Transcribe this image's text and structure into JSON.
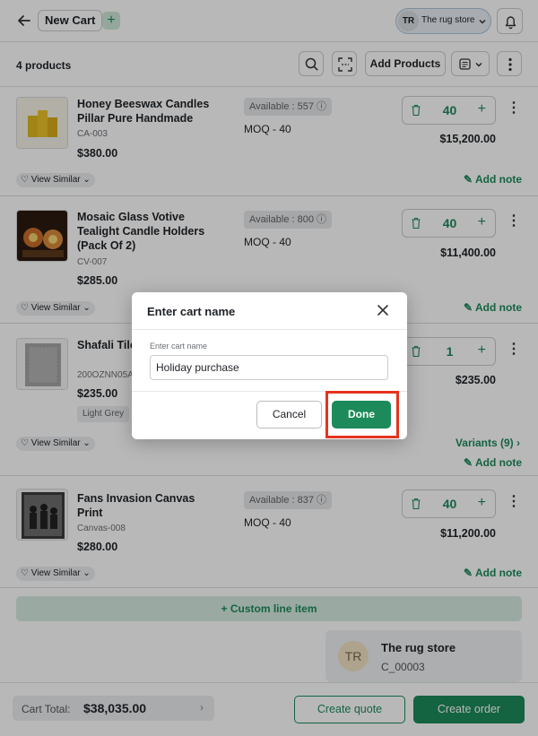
{
  "header": {
    "cart_name": "New Cart",
    "add_icon": "plus-icon",
    "store_initials": "TR",
    "store_name": "The rug store"
  },
  "toolbar": {
    "product_count": "4 products",
    "add_products_label": "Add Products"
  },
  "products": [
    {
      "name": "Honey Beeswax Candles Pillar Pure Handmade",
      "sku": "CA-003",
      "price": "$380.00",
      "available": "Available : 557",
      "moq": "MOQ - 40",
      "quantity": "40",
      "total": "$15,200.00",
      "view_similar": "View Similar",
      "add_note": "Add note"
    },
    {
      "name": "Mosaic Glass Votive Tealight Candle Holders (Pack Of 2)",
      "sku": "CV-007",
      "price": "$285.00",
      "available": "Available : 800",
      "moq": "MOQ - 40",
      "quantity": "40",
      "total": "$11,400.00",
      "view_similar": "View Similar",
      "add_note": "Add note"
    },
    {
      "name": "Shafali Tiled Rug",
      "sku": "200OZNN05A",
      "price": "$235.00",
      "tag": "Light Grey",
      "quantity": "1",
      "total": "$235.00",
      "view_similar": "View Similar",
      "variants": "Variants (9)",
      "add_note": "Add note"
    },
    {
      "name": "Fans Invasion Canvas Print",
      "sku": "Canvas-008",
      "price": "$280.00",
      "available": "Available : 837",
      "moq": "MOQ - 40",
      "quantity": "40",
      "total": "$11,200.00",
      "view_similar": "View Similar",
      "add_note": "Add note"
    }
  ],
  "custom_line_item": "+ Custom line item",
  "customer": {
    "initials": "TR",
    "name": "The rug store",
    "code": "C_00003"
  },
  "footer": {
    "cart_total_label": "Cart Total:",
    "cart_total_value": "$38,035.00",
    "create_quote": "Create quote",
    "create_order": "Create order"
  },
  "modal": {
    "title": "Enter cart name",
    "field_label": "Enter cart name",
    "field_value": "Holiday purchase",
    "cancel_label": "Cancel",
    "done_label": "Done"
  },
  "colors": {
    "accent": "#1c8a5a",
    "highlight": "#e5341d"
  }
}
